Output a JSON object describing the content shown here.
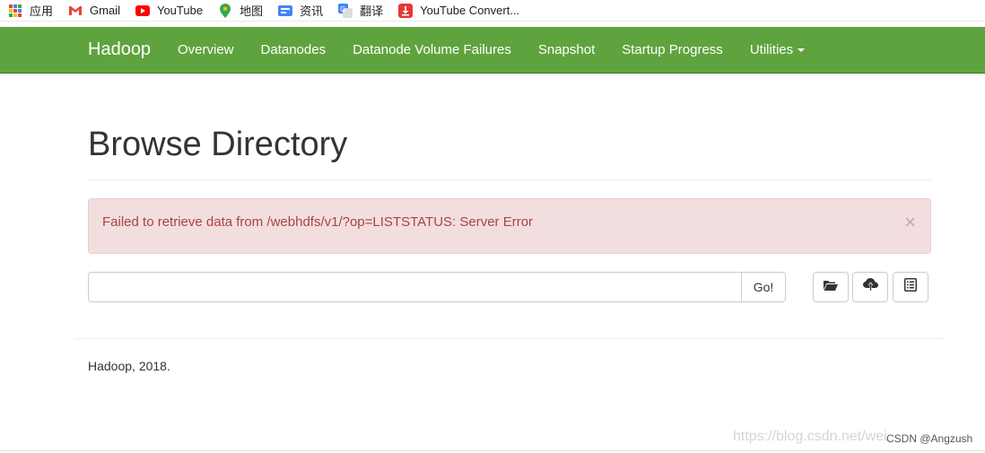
{
  "bookmarks": [
    {
      "label": "应用",
      "icon": "apps-grid-icon"
    },
    {
      "label": "Gmail",
      "icon": "gmail-icon"
    },
    {
      "label": "YouTube",
      "icon": "youtube-icon"
    },
    {
      "label": "地图",
      "icon": "maps-pin-icon"
    },
    {
      "label": "资讯",
      "icon": "news-icon"
    },
    {
      "label": "翻译",
      "icon": "translate-icon"
    },
    {
      "label": "YouTube Convert...",
      "icon": "download-icon"
    }
  ],
  "navbar": {
    "brand": "Hadoop",
    "items": [
      "Overview",
      "Datanodes",
      "Datanode Volume Failures",
      "Snapshot",
      "Startup Progress",
      "Utilities"
    ],
    "color": "#5fa33e"
  },
  "page": {
    "title": "Browse Directory"
  },
  "alert": {
    "message": "Failed to retrieve data from /webhdfs/v1/?op=LISTSTATUS: Server Error",
    "close": "×"
  },
  "path_bar": {
    "value": "",
    "go_label": "Go!"
  },
  "toolbar": {
    "icons": [
      "folder-open-icon",
      "cloud-upload-icon",
      "list-alt-icon"
    ]
  },
  "footer": {
    "text": "Hadoop, 2018."
  },
  "watermark": {
    "url": "https://blog.csdn.net/wei",
    "author": "CSDN @Angzush"
  }
}
